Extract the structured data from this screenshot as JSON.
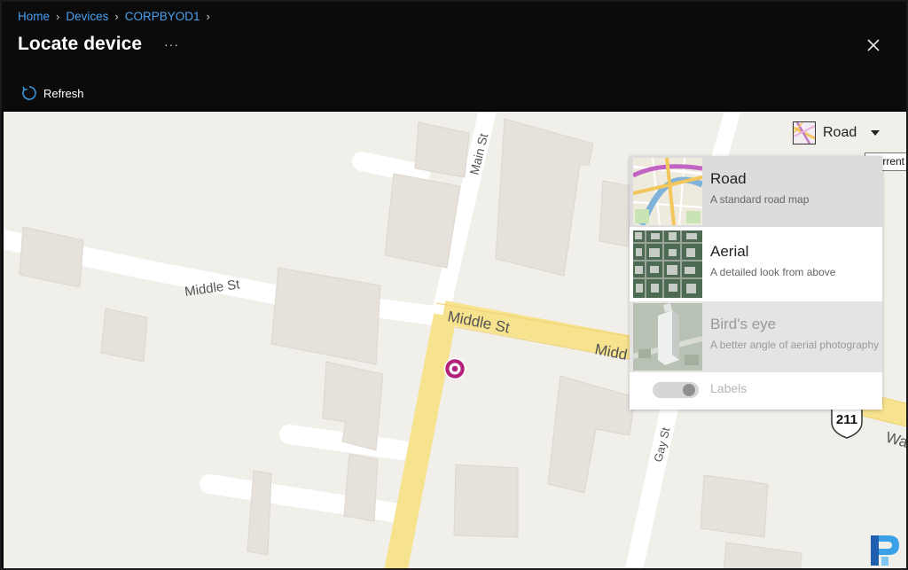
{
  "header": {
    "breadcrumb": [
      {
        "label": "Home"
      },
      {
        "label": "Devices"
      },
      {
        "label": "CORPBYOD1"
      }
    ],
    "title": "Locate device",
    "more_label": "···",
    "refresh_label": "Refresh"
  },
  "map": {
    "street_labels": {
      "main_st": "Main St",
      "middle_st_west": "Middle St",
      "middle_st_center": "Middle St",
      "middle_st_east": "Midd",
      "gay_st": "Gay St",
      "wa": "Wa"
    },
    "route_shield": "211",
    "style_control": {
      "current_label": "Road",
      "tooltip": "Current"
    },
    "style_menu": {
      "items": [
        {
          "title": "Road",
          "description": "A standard road map"
        },
        {
          "title": "Aerial",
          "description": "A detailed look from above"
        },
        {
          "title": "Bird's eye",
          "description": "A better angle of aerial photography"
        }
      ],
      "labels_toggle_label": "Labels"
    },
    "colors": {
      "land": "#f1efe9",
      "building": "#e6e1da",
      "minor_road": "#ffffff",
      "major_road": "#f7e28e",
      "pin": "#b2227c"
    }
  },
  "brand": {
    "watermark_icon": "prajwal-p-logo-icon"
  }
}
